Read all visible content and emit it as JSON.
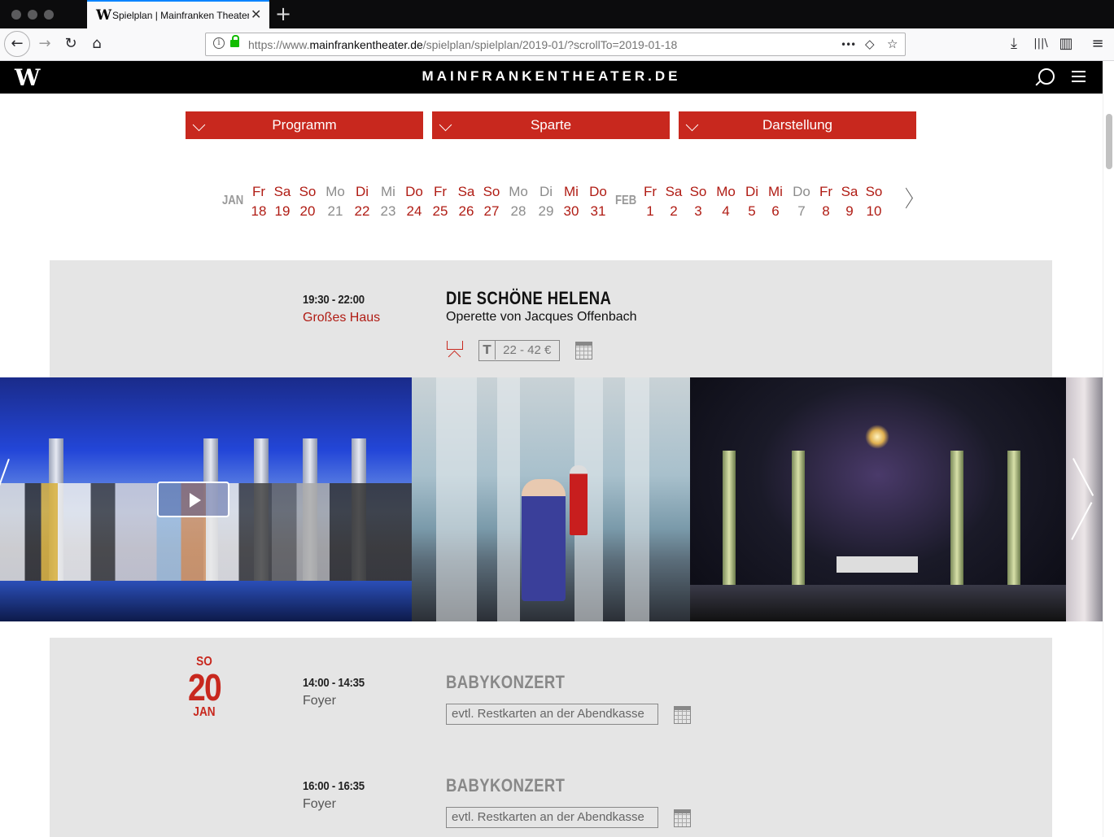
{
  "browser": {
    "tab_title": "Spielplan | Mainfranken Theater",
    "tab_close": "✕",
    "new_tab": "+",
    "url_prefix": "https://www.",
    "url_domain": "mainfrankentheater.de",
    "url_path": "/spielplan/spielplan/2019-01/?scrollTo=2019-01-18",
    "nav": {
      "back": "←",
      "forward": "→",
      "reload": "↻",
      "home": "⌂"
    },
    "url_actions": {
      "more": "•••",
      "pocket": "◇",
      "bookmark": "☆"
    },
    "toolbar": {
      "download": "⤓",
      "library": "|||\\",
      "sidebar": "▥",
      "menu": "≡"
    }
  },
  "site": {
    "logo": "W",
    "name": "MAINFRANKENTHEATER.DE"
  },
  "filters": [
    "Programm",
    "Sparte",
    "Darstellung"
  ],
  "dates": {
    "months": [
      "JAN",
      "FEB"
    ],
    "days": [
      {
        "wd": "Fr",
        "d": "18",
        "active": true
      },
      {
        "wd": "Sa",
        "d": "19",
        "active": true
      },
      {
        "wd": "So",
        "d": "20",
        "active": true
      },
      {
        "wd": "Mo",
        "d": "21",
        "active": false
      },
      {
        "wd": "Di",
        "d": "22",
        "active": true
      },
      {
        "wd": "Mi",
        "d": "23",
        "active": false
      },
      {
        "wd": "Do",
        "d": "24",
        "active": true
      },
      {
        "wd": "Fr",
        "d": "25",
        "active": true
      },
      {
        "wd": "Sa",
        "d": "26",
        "active": true
      },
      {
        "wd": "So",
        "d": "27",
        "active": true
      },
      {
        "wd": "Mo",
        "d": "28",
        "active": false
      },
      {
        "wd": "Di",
        "d": "29",
        "active": false
      },
      {
        "wd": "Mi",
        "d": "30",
        "active": true
      },
      {
        "wd": "Do",
        "d": "31",
        "active": true
      },
      {
        "wd": "Fr",
        "d": "1",
        "active": true
      },
      {
        "wd": "Sa",
        "d": "2",
        "active": true
      },
      {
        "wd": "So",
        "d": "3",
        "active": true
      },
      {
        "wd": "Mo",
        "d": "4",
        "active": true
      },
      {
        "wd": "Di",
        "d": "5",
        "active": true
      },
      {
        "wd": "Mi",
        "d": "6",
        "active": true
      },
      {
        "wd": "Do",
        "d": "7",
        "active": false
      },
      {
        "wd": "Fr",
        "d": "8",
        "active": true
      },
      {
        "wd": "Sa",
        "d": "9",
        "active": true
      },
      {
        "wd": "So",
        "d": "10",
        "active": true
      }
    ]
  },
  "events": [
    {
      "time": "19:30 - 22:00",
      "venue": "Großes Haus",
      "title": "DIE SCHÖNE HELENA",
      "subtitle": "Operette von Jacques Offenbach",
      "price_tag": "T",
      "price": "22 - 42 €"
    }
  ],
  "day_block": {
    "weekday": "SO",
    "day": "20",
    "month": "JAN"
  },
  "day_events": [
    {
      "time": "14:00 - 14:35",
      "venue": "Foyer",
      "title": "BABYKONZERT",
      "note": "evtl. Restkarten an der Abendkasse"
    },
    {
      "time": "16:00 - 16:35",
      "venue": "Foyer",
      "title": "BABYKONZERT",
      "note": "evtl. Restkarten an der Abendkasse"
    }
  ],
  "colors": {
    "accent": "#c8281e",
    "active_date": "#b01c14",
    "inactive_date": "#8c8c8c",
    "band": "#e5e5e5"
  }
}
